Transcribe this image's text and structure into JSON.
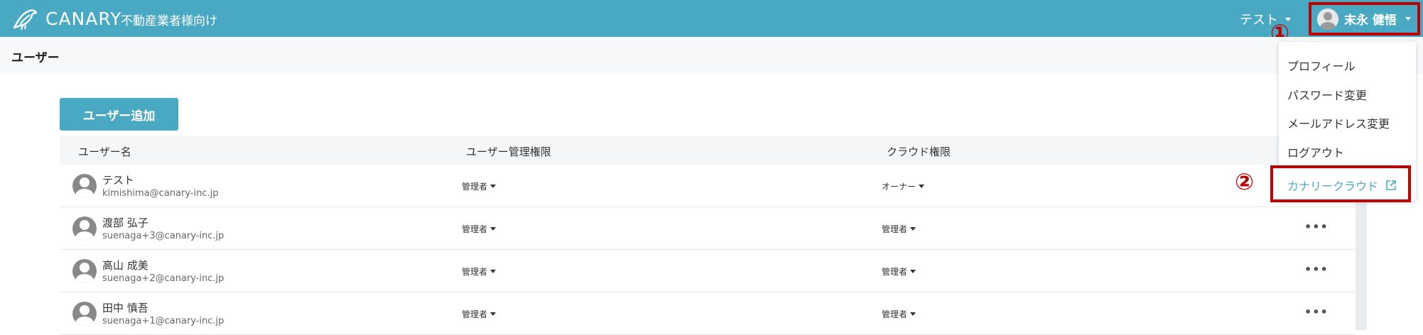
{
  "app": {
    "brand": "CANARY",
    "subtitle": "不動産業者様向け"
  },
  "header": {
    "org_label": "テスト",
    "user_name": "末永 健悟"
  },
  "markers": {
    "one": "①",
    "two": "②"
  },
  "page": {
    "title": "ユーザー",
    "add_button": "ユーザー追加"
  },
  "table": {
    "columns": [
      "ユーザー名",
      "ユーザー管理権限",
      "クラウド権限"
    ],
    "rows": [
      {
        "name": "テスト",
        "email": "kimishima@canary-inc.jp",
        "user_role": "管理者",
        "cloud_role": "オーナー",
        "more": ""
      },
      {
        "name": "渡部 弘子",
        "email": "suenaga+3@canary-inc.jp",
        "user_role": "管理者",
        "cloud_role": "管理者",
        "more": "•••"
      },
      {
        "name": "高山 成美",
        "email": "suenaga+2@canary-inc.jp",
        "user_role": "管理者",
        "cloud_role": "管理者",
        "more": "•••"
      },
      {
        "name": "田中 慎吾",
        "email": "suenaga+1@canary-inc.jp",
        "user_role": "管理者",
        "cloud_role": "管理者",
        "more": "•••"
      }
    ]
  },
  "dropdown": {
    "items": [
      "プロフィール",
      "パスワード変更",
      "メールアドレス変更",
      "ログアウト"
    ],
    "cloud_link": "カナリークラウド"
  },
  "colors": {
    "accent": "#4aa9c2",
    "highlight": "#c00000"
  },
  "icons": {
    "logo": "canary-bird-icon",
    "avatar": "user-avatar-icon",
    "external": "external-link-icon"
  }
}
